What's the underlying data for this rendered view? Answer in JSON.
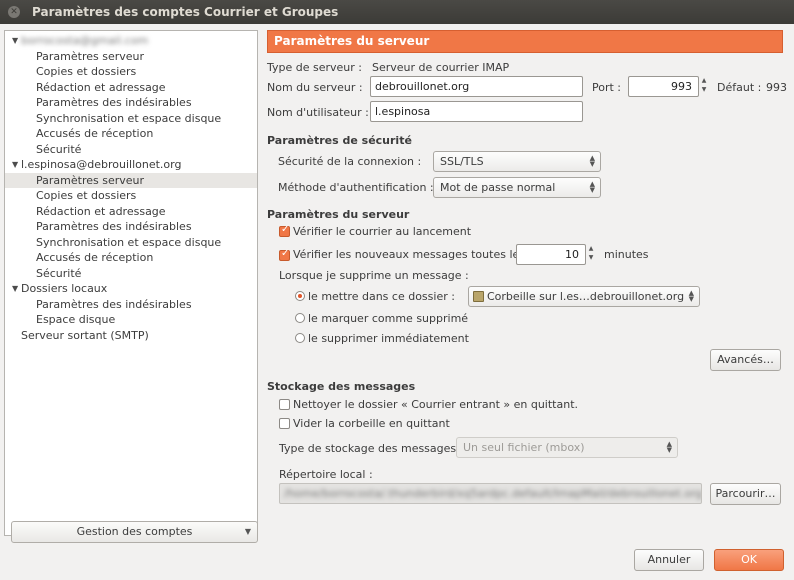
{
  "window": {
    "title": "Paramètres des comptes Courrier et Groupes"
  },
  "sidebar": {
    "items": [
      {
        "label": "borrocosta@gmail.com",
        "level": 0,
        "blurred": true,
        "expanded": true
      },
      {
        "label": "Paramètres serveur",
        "level": 1
      },
      {
        "label": "Copies et dossiers",
        "level": 1
      },
      {
        "label": "Rédaction et adressage",
        "level": 1
      },
      {
        "label": "Paramètres des indésirables",
        "level": 1
      },
      {
        "label": "Synchronisation et espace disque",
        "level": 1
      },
      {
        "label": "Accusés de réception",
        "level": 1
      },
      {
        "label": "Sécurité",
        "level": 1
      },
      {
        "label": "l.espinosa@debrouillonet.org",
        "level": 0,
        "expanded": true
      },
      {
        "label": "Paramètres serveur",
        "level": 1,
        "selected": true
      },
      {
        "label": "Copies et dossiers",
        "level": 1
      },
      {
        "label": "Rédaction et adressage",
        "level": 1
      },
      {
        "label": "Paramètres des indésirables",
        "level": 1
      },
      {
        "label": "Synchronisation et espace disque",
        "level": 1
      },
      {
        "label": "Accusés de réception",
        "level": 1
      },
      {
        "label": "Sécurité",
        "level": 1
      },
      {
        "label": "Dossiers locaux",
        "level": 0,
        "expanded": true
      },
      {
        "label": "Paramètres des indésirables",
        "level": 1
      },
      {
        "label": "Espace disque",
        "level": 1
      },
      {
        "label": "Serveur sortant (SMTP)",
        "level": 0,
        "noarrow": true
      }
    ],
    "manage_button": "Gestion des comptes"
  },
  "main": {
    "header": "Paramètres du serveur",
    "server_type_label": "Type de serveur :",
    "server_type_value": "Serveur de courrier IMAP",
    "server_name_label": "Nom du serveur :",
    "server_name_value": "debrouillonet.org",
    "port_label": "Port :",
    "port_value": "993",
    "default_label": "Défaut :",
    "default_value": "993",
    "username_label": "Nom d'utilisateur :",
    "username_value": "l.espinosa",
    "security_heading": "Paramètres de sécurité",
    "conn_security_label": "Sécurité de la connexion :",
    "conn_security_value": "SSL/TLS",
    "auth_label": "Méthode d'authentification :",
    "auth_value": "Mot de passe normal",
    "server_heading": "Paramètres du serveur",
    "check_startup": "Vérifier le courrier au lancement",
    "check_every": "Vérifier les nouveaux messages toutes les",
    "check_minutes_value": "10",
    "minutes_label": "minutes",
    "delete_label": "Lorsque je supprime un message :",
    "radio_move": "le mettre dans ce dossier :",
    "folder_value": "Corbeille sur l.es…debrouillonet.org",
    "radio_mark": "le marquer comme supprimé",
    "radio_delete": "le supprimer immédiatement",
    "advanced_button": "Avancés…",
    "storage_heading": "Stockage des messages",
    "clean_inbox": "Nettoyer le dossier « Courrier entrant » en quittant.",
    "empty_trash": "Vider la corbeille en quittant",
    "storage_type_label": "Type de stockage des messages :",
    "storage_type_value": "Un seul fichier (mbox)",
    "local_dir_label": "Répertoire local :",
    "local_dir_value": "/home/borrocosta/.thunderbird/xq5ardpc.default/ImapMail/debrouillonet.org",
    "browse_button": "Parcourir…"
  },
  "footer": {
    "cancel": "Annuler",
    "ok": "OK"
  },
  "colors": {
    "accent": "#f07746",
    "titlebar": "#3c3b37"
  }
}
